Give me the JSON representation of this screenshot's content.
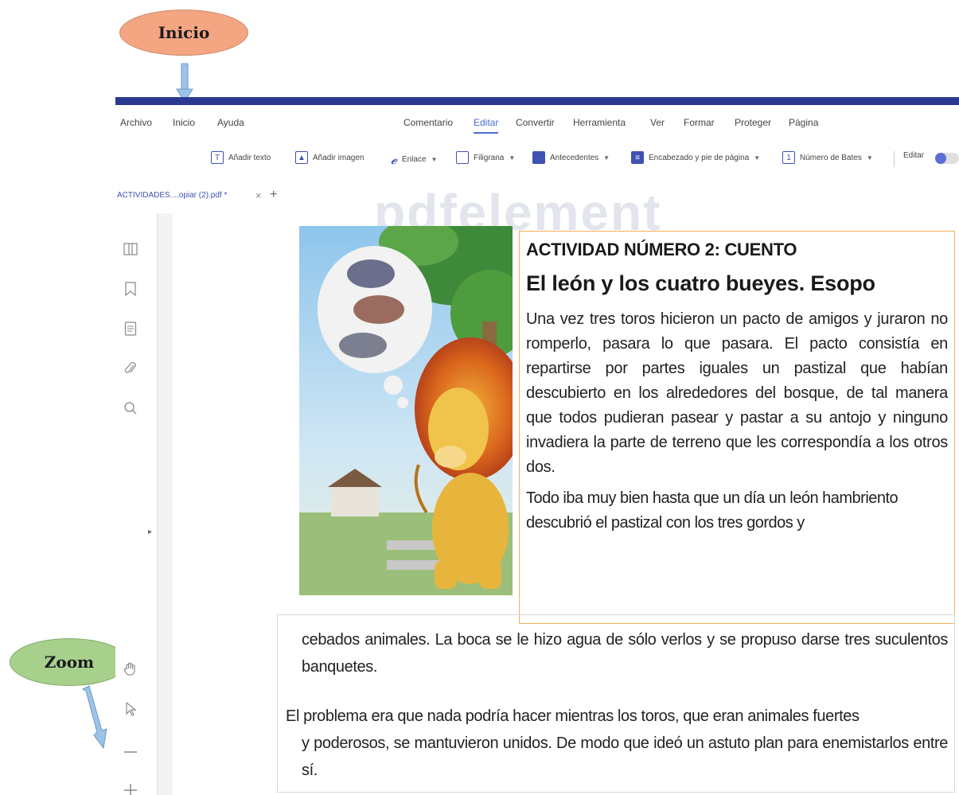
{
  "callouts": {
    "inicio": "Inicio",
    "zoom": "Zoom"
  },
  "menu": {
    "items": [
      "Archivo",
      "Inicio",
      "Ayuda",
      "Comentario",
      "Editar",
      "Convertir",
      "Herramienta",
      "Ver",
      "Formar",
      "Proteger",
      "Página"
    ],
    "active": "Editar"
  },
  "toolbar": {
    "add_text": "Añadir texto",
    "add_image": "Añadir imagen",
    "link": "Enlace",
    "watermark": "Filigrana",
    "background": "Antecedentes",
    "header_footer": "Encabezado y pie de página",
    "bates": "Número de Bates",
    "edit": "Editar"
  },
  "tab": {
    "filename": "ACTIVIDADES....opiar (2).pdf *",
    "close": "×",
    "add": "+"
  },
  "document": {
    "watermark": "pdfelement",
    "activity_title": "ACTIVIDAD NÚMERO 2: CUENTO",
    "story_title": "El león y los cuatro bueyes. Esopo",
    "paragraph1": "Una vez tres toros hicieron un pacto de amigos y juraron no romperlo, pasara lo que pasara. El pacto consistía en repartirse por partes iguales un pastizal que habían descubierto en los alrededores del bosque, de tal manera que todos pudieran pasear y pastar a su antojo y ninguno invadiera la parte de terreno que les correspondía a los otros dos.",
    "paragraph2_start": "Todo iba muy bien hasta que un día un león hambriento descubrió el pastizal con los tres gordos y",
    "paragraph2_cont": "cebados animales. La boca se le hizo agua de sólo verlos y se propuso darse tres suculentos banquetes.",
    "paragraph3_first": "El problema era que nada podría hacer mientras los toros, que eran animales fuertes",
    "paragraph3_rest": "y poderosos, se mantuvieron unidos. De modo que ideó un astuto plan para enemistarlos entre sí."
  },
  "colors": {
    "title_bar": "#2b3990",
    "accent": "#4a6cd4",
    "callout_inicio": "#f4a582",
    "callout_zoom": "#a8d08d",
    "textbox_border": "#f0b25a"
  }
}
